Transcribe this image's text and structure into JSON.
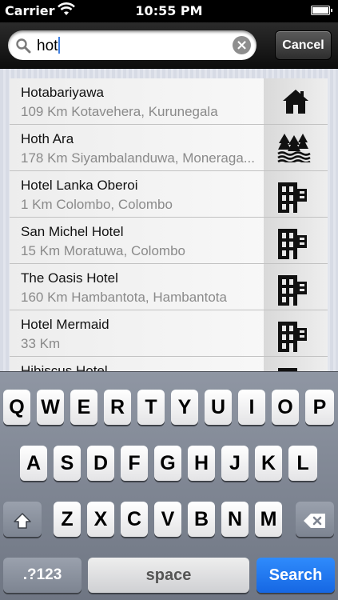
{
  "status_bar": {
    "carrier": "Carrier",
    "time": "10:55 PM",
    "icons": [
      "wifi-icon",
      "battery-icon"
    ]
  },
  "search": {
    "query": "hot",
    "cancel_label": "Cancel",
    "icons": [
      "magnifier-icon",
      "clear-icon"
    ]
  },
  "results": [
    {
      "title": "Hotabariyawa",
      "subtitle": "109 Km Kotavehera, Kurunegala",
      "icon": "house-icon"
    },
    {
      "title": "Hoth Ara",
      "subtitle": "178 Km Siyambalanduwa, Moneraga...",
      "icon": "forest-lake-icon"
    },
    {
      "title": "Hotel Lanka Oberoi",
      "subtitle": "1 Km Colombo, Colombo",
      "icon": "hotel-icon"
    },
    {
      "title": "San Michel Hotel",
      "subtitle": "15 Km Moratuwa, Colombo",
      "icon": "hotel-icon"
    },
    {
      "title": "The Oasis Hotel",
      "subtitle": "160 Km Hambantota, Hambantota",
      "icon": "hotel-icon"
    },
    {
      "title": "Hotel Mermaid",
      "subtitle": "33 Km",
      "icon": "hotel-icon"
    },
    {
      "title": "Hibiscus Hotel",
      "subtitle": "",
      "icon": "hotel-icon"
    }
  ],
  "keyboard": {
    "row1": [
      "Q",
      "W",
      "E",
      "R",
      "T",
      "Y",
      "U",
      "I",
      "O",
      "P"
    ],
    "row2": [
      "A",
      "S",
      "D",
      "F",
      "G",
      "H",
      "J",
      "K",
      "L"
    ],
    "row3": [
      "Z",
      "X",
      "C",
      "V",
      "B",
      "N",
      "M"
    ],
    "shift_icon": "shift-icon",
    "delete_icon": "delete-icon",
    "numbers_label": ".?123",
    "space_label": "space",
    "search_label": "Search"
  },
  "colors": {
    "search_key": "#1f77f0",
    "caret": "#3f7fe0"
  }
}
